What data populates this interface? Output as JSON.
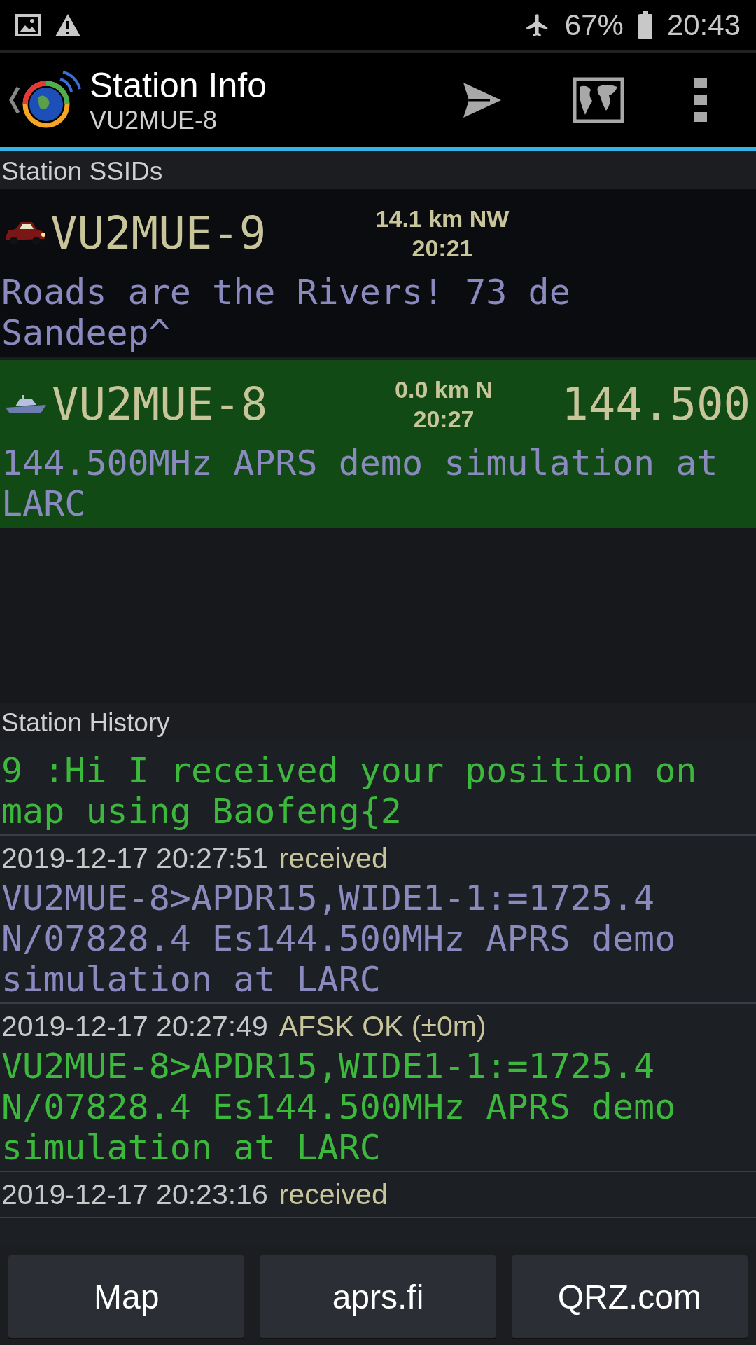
{
  "status_bar": {
    "battery": "67%",
    "time": "20:43"
  },
  "toolbar": {
    "title": "Station Info",
    "subtitle": "VU2MUE-8"
  },
  "ssids": {
    "heading": "Station SSIDs",
    "items": [
      {
        "kind": "car",
        "callsign": "VU2MUE-9",
        "distance": "14.1 km NW",
        "time": "20:21",
        "comment": "Roads are the Rivers! 73 de Sandeep^",
        "selected": false
      },
      {
        "kind": "boat",
        "callsign": "VU2MUE-8",
        "distance": "0.0 km N",
        "time": "20:27",
        "frequency": "144.500",
        "comment": "144.500MHz APRS demo simulation at LARC",
        "selected": true
      }
    ]
  },
  "history": {
    "heading": "Station History",
    "entries": [
      {
        "message": "9 :Hi I received your position on map using Baofeng{2",
        "color": "#3cb83c"
      },
      {
        "timestamp": "2019-12-17 20:27:51",
        "status": "received",
        "message": "VU2MUE-8>APDR15,WIDE1-1:=1725.4 N/07828.4 Es144.500MHz APRS demo simulation at LARC",
        "color": "#8a8abf"
      },
      {
        "timestamp": "2019-12-17 20:27:49",
        "status": "AFSK OK (±0m)",
        "message": "VU2MUE-8>APDR15,WIDE1-1:=1725.4 N/07828.4 Es144.500MHz APRS demo simulation at LARC",
        "color": "#3cb83c"
      },
      {
        "timestamp": "2019-12-17 20:23:16",
        "status": "received"
      }
    ]
  },
  "buttons": [
    "Map",
    "aprs.fi",
    "QRZ.com"
  ]
}
